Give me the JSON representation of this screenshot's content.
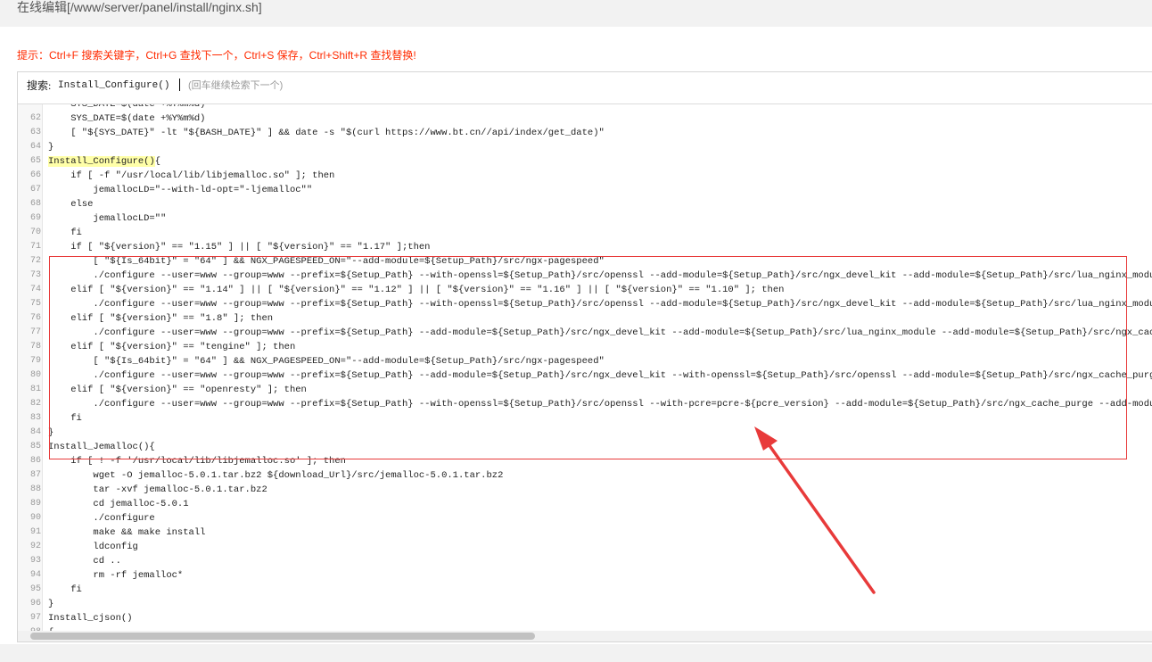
{
  "window": {
    "title": "在线编辑[/www/server/panel/install/nginx.sh]"
  },
  "hint": "提示：Ctrl+F 搜索关键字，Ctrl+G 查找下一个，Ctrl+S 保存，Ctrl+Shift+R 查找替换!",
  "search": {
    "label": "搜索:",
    "value": "Install_Configure()",
    "tip": "(回车继续检索下一个)"
  },
  "editor": {
    "lines": [
      {
        "n": "",
        "text": "    SYS_DATE=$(date +%Y%m%d)"
      },
      {
        "n": "62",
        "text": "    SYS_DATE=$(date +%Y%m%d)"
      },
      {
        "n": "63",
        "text": "    [ \"${SYS_DATE}\" -lt \"${BASH_DATE}\" ] && date -s \"$(curl https://www.bt.cn//api/index/get_date)\""
      },
      {
        "n": "64",
        "text": "}"
      },
      {
        "n": "65",
        "text": "Install_Configure(){"
      },
      {
        "n": "66",
        "text": "    if [ -f \"/usr/local/lib/libjemalloc.so\" ]; then"
      },
      {
        "n": "67",
        "text": "        jemallocLD=\"--with-ld-opt=\"-ljemalloc\"\""
      },
      {
        "n": "68",
        "text": "    else"
      },
      {
        "n": "69",
        "text": "        jemallocLD=\"\""
      },
      {
        "n": "70",
        "text": "    fi"
      },
      {
        "n": "71",
        "text": "    if [ \"${version}\" == \"1.15\" ] || [ \"${version}\" == \"1.17\" ];then"
      },
      {
        "n": "72",
        "text": "        [ \"${Is_64bit}\" = \"64\" ] && NGX_PAGESPEED_ON=\"--add-module=${Setup_Path}/src/ngx-pagespeed\""
      },
      {
        "n": "73",
        "text": "        ./configure --user=www --group=www --prefix=${Setup_Path} --with-openssl=${Setup_Path}/src/openssl --add-module=${Setup_Path}/src/ngx_devel_kit --add-module=${Setup_Path}/src/lua_nginx_module --add-mo"
      },
      {
        "n": "74",
        "text": "    elif [ \"${version}\" == \"1.14\" ] || [ \"${version}\" == \"1.12\" ] || [ \"${version}\" == \"1.16\" ] || [ \"${version}\" == \"1.10\" ]; then"
      },
      {
        "n": "75",
        "text": "        ./configure --user=www --group=www --prefix=${Setup_Path} --with-openssl=${Setup_Path}/src/openssl --add-module=${Setup_Path}/src/ngx_devel_kit --add-module=${Setup_Path}/src/lua_nginx_module --add-mo"
      },
      {
        "n": "76",
        "text": "    elif [ \"${version}\" == \"1.8\" ]; then"
      },
      {
        "n": "77",
        "text": "        ./configure --user=www --group=www --prefix=${Setup_Path} --add-module=${Setup_Path}/src/ngx_devel_kit --add-module=${Setup_Path}/src/lua_nginx_module --add-module=${Setup_Path}/src/ngx_cache_purge --"
      },
      {
        "n": "78",
        "text": "    elif [ \"${version}\" == \"tengine\" ]; then"
      },
      {
        "n": "79",
        "text": "        [ \"${Is_64bit}\" = \"64\" ] && NGX_PAGESPEED_ON=\"--add-module=${Setup_Path}/src/ngx-pagespeed\""
      },
      {
        "n": "80",
        "text": "        ./configure --user=www --group=www --prefix=${Setup_Path} --add-module=${Setup_Path}/src/ngx_devel_kit --with-openssl=${Setup_Path}/src/openssl --add-module=${Setup_Path}/src/ngx_cache_purge --add-mo"
      },
      {
        "n": "81",
        "text": "    elif [ \"${version}\" == \"openresty\" ]; then"
      },
      {
        "n": "82",
        "text": "        ./configure --user=www --group=www --prefix=${Setup_Path} --with-openssl=${Setup_Path}/src/openssl --with-pcre=pcre-${pcre_version} --add-module=${Setup_Path}/src/ngx_cache_purge --add-module=${Setup"
      },
      {
        "n": "83",
        "text": "    fi"
      },
      {
        "n": "84",
        "text": "}"
      },
      {
        "n": "85",
        "text": "Install_Jemalloc(){"
      },
      {
        "n": "86",
        "text": "    if [ ! -f '/usr/local/lib/libjemalloc.so' ]; then"
      },
      {
        "n": "87",
        "text": "        wget -O jemalloc-5.0.1.tar.bz2 ${download_Url}/src/jemalloc-5.0.1.tar.bz2"
      },
      {
        "n": "88",
        "text": "        tar -xvf jemalloc-5.0.1.tar.bz2"
      },
      {
        "n": "89",
        "text": "        cd jemalloc-5.0.1"
      },
      {
        "n": "90",
        "text": "        ./configure"
      },
      {
        "n": "91",
        "text": "        make && make install"
      },
      {
        "n": "92",
        "text": "        ldconfig"
      },
      {
        "n": "93",
        "text": "        cd .."
      },
      {
        "n": "94",
        "text": "        rm -rf jemalloc*"
      },
      {
        "n": "95",
        "text": "    fi"
      },
      {
        "n": "96",
        "text": "}"
      },
      {
        "n": "97",
        "text": "Install_cjson()"
      },
      {
        "n": "98",
        "text": "{"
      }
    ]
  },
  "colors": {
    "hint": "#ff2a00",
    "highlight_box": "#e83a3a",
    "match_highlight": "#ffffa8"
  }
}
